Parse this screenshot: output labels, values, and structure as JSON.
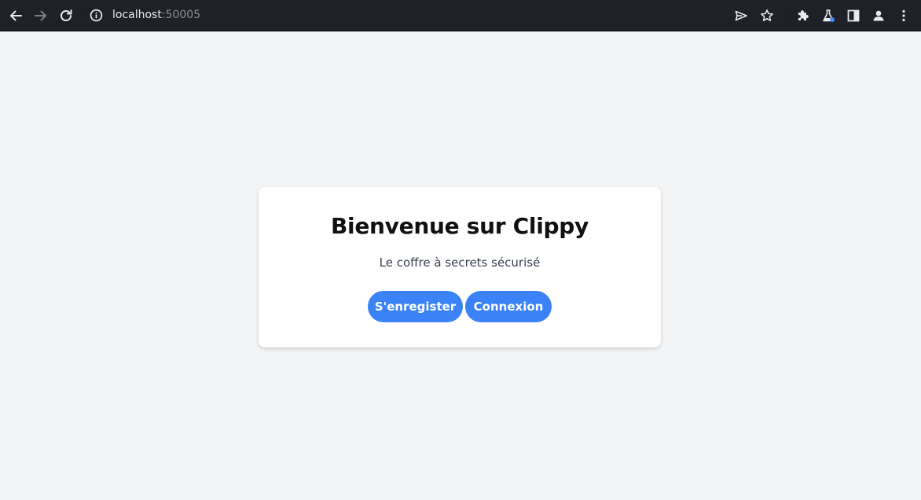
{
  "browser": {
    "url_host": "localhost",
    "url_port": ":50005"
  },
  "card": {
    "title": "Bienvenue sur Clippy",
    "subtitle": "Le coffre à secrets sécurisé",
    "register_label": "S'enregister",
    "login_label": "Connexion"
  },
  "colors": {
    "page_background": "#f3f4f6",
    "chrome_background": "#1f2129",
    "primary": "#3b82f6",
    "card_background": "#ffffff"
  },
  "icons": [
    "back-icon",
    "forward-icon",
    "reload-icon",
    "info-icon",
    "send-icon",
    "star-icon",
    "extensions-icon",
    "labs-icon",
    "side-panel-icon",
    "profile-icon",
    "menu-icon"
  ]
}
